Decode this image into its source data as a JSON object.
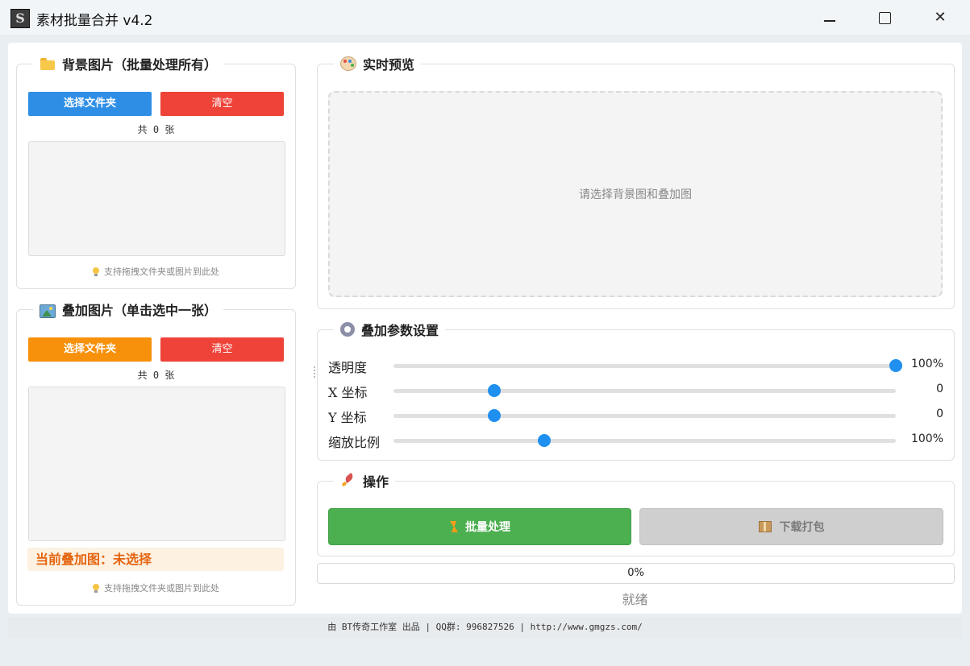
{
  "window": {
    "title": "素材批量合并 v4.2",
    "app_icon": "S"
  },
  "background_panel": {
    "title": "背景图片（批量处理所有）",
    "select_button": "选择文件夹",
    "clear_button": "清空",
    "count": "共 0 张",
    "hint": "支持拖拽文件夹或图片到此处"
  },
  "overlay_panel": {
    "title": "叠加图片（单击选中一张）",
    "select_button": "选择文件夹",
    "clear_button": "清空",
    "count": "共 0 张",
    "current": "当前叠加图：未选择",
    "hint": "支持拖拽文件夹或图片到此处"
  },
  "preview_panel": {
    "title": "实时预览",
    "placeholder": "请选择背景图和叠加图"
  },
  "params_panel": {
    "title": "叠加参数设置",
    "params": [
      {
        "label": "透明度",
        "value": "100%",
        "level": 1.0
      },
      {
        "label": "X 坐标",
        "value": "0",
        "level": 0.2
      },
      {
        "label": "Y 坐标",
        "value": "0",
        "level": 0.2
      },
      {
        "label": "缩放比例",
        "value": "100%",
        "level": 0.3
      }
    ]
  },
  "actions_panel": {
    "title": "操作",
    "batch_button": "批量处理",
    "download_button": "下载打包"
  },
  "progress": {
    "text": "0%",
    "status": "就绪"
  },
  "footer": {
    "text": "由 BT传奇工作室 出品  |  QQ群: 996827526  |  http://www.gmgzs.com/"
  },
  "colors": {
    "blue": "#2e8ee6",
    "red": "#ef4339",
    "orange": "#f7900a",
    "green": "#4caf50",
    "slider": "#1f8ff0"
  }
}
